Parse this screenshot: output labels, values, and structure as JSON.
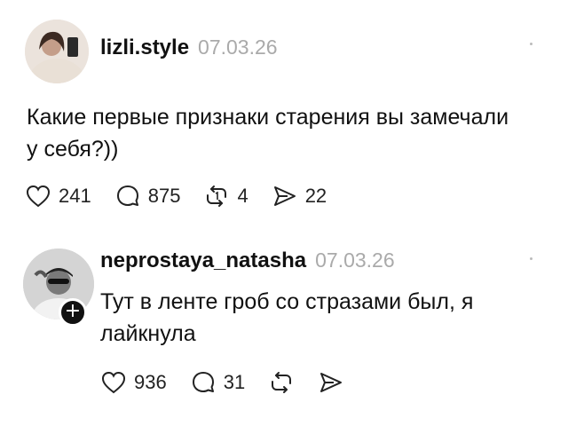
{
  "posts": [
    {
      "username": "lizli.style",
      "date": "07.03.26",
      "text": "Какие первые признаки старения вы замечали у себя?))",
      "likes": "241",
      "comments": "875",
      "reposts": "4",
      "shares": "22"
    },
    {
      "username": "neprostaya_natasha",
      "date": "07.03.26",
      "text": "Тут в ленте гроб со стразами был, я лайкнула",
      "likes": "936",
      "comments": "31",
      "follow_badge": "+"
    }
  ],
  "icons": {
    "like": "heart-icon",
    "comment": "comment-bubble-icon",
    "repost": "repost-icon",
    "share": "send-icon"
  }
}
